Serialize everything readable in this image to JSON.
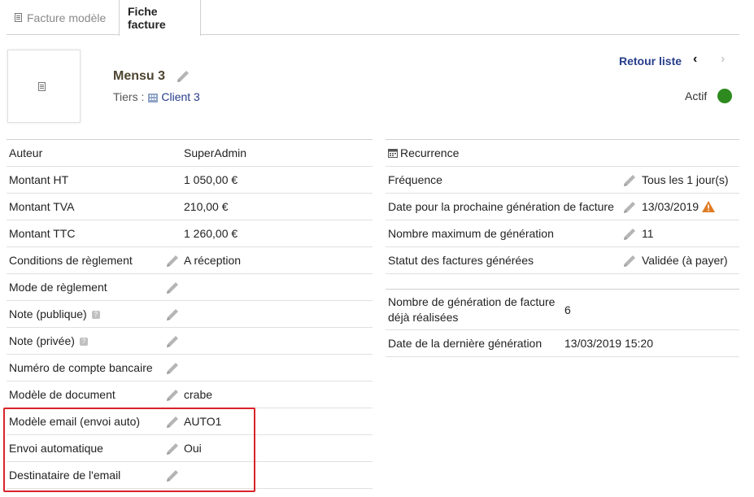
{
  "tabs": [
    {
      "label": "Facture modèle",
      "active": false
    },
    {
      "label": "Fiche facture",
      "active": true
    }
  ],
  "header": {
    "title": "Mensu 3",
    "tiers_label": "Tiers :",
    "tiers_value": "Client 3",
    "retour_label": "Retour liste",
    "status_label": "Actif",
    "status_color": "#2e8a1f"
  },
  "left_table": [
    {
      "label": "Auteur",
      "value": "SuperAdmin",
      "editable": false
    },
    {
      "label": "Montant HT",
      "value": "1 050,00 €",
      "editable": false
    },
    {
      "label": "Montant TVA",
      "value": "210,00 €",
      "editable": false
    },
    {
      "label": "Montant TTC",
      "value": "1 260,00 €",
      "editable": false
    },
    {
      "label": "Conditions de règlement",
      "value": "A réception",
      "editable": true
    },
    {
      "label": "Mode de règlement",
      "value": "",
      "editable": true
    },
    {
      "label": "Note (publique)",
      "value": "",
      "editable": true,
      "help": true
    },
    {
      "label": "Note (privée)",
      "value": "",
      "editable": true,
      "help": true
    },
    {
      "label": "Numéro de compte bancaire",
      "value": "",
      "editable": true
    },
    {
      "label": "Modèle de document",
      "value": "crabe",
      "editable": true
    },
    {
      "label": "Modèle email (envoi auto)",
      "value": "AUTO1",
      "editable": true
    },
    {
      "label": "Envoi automatique",
      "value": "Oui",
      "editable": true
    },
    {
      "label": "Destinataire de l'email",
      "value": "",
      "editable": true
    }
  ],
  "recurrence": {
    "heading": "Recurrence",
    "rows": [
      {
        "label": "Fréquence",
        "value": "Tous les 1 jour(s)"
      },
      {
        "label": "Date pour la prochaine génération de facture",
        "value": "13/03/2019",
        "warning": true
      },
      {
        "label": "Nombre maximum de génération",
        "value": "11"
      },
      {
        "label": "Statut des factures générées",
        "value": "Validée (à payer)"
      }
    ]
  },
  "generation": {
    "count_label_line1": "Nombre de génération de facture",
    "count_label_line2": "déjà réalisées",
    "count_value": "6",
    "last_label": "Date de la dernière génération",
    "last_value": "13/03/2019 15:20"
  },
  "colors": {
    "link": "#263c8a",
    "title": "#4e4432",
    "highlight": "#d9232a",
    "warning": "#e07b24"
  }
}
